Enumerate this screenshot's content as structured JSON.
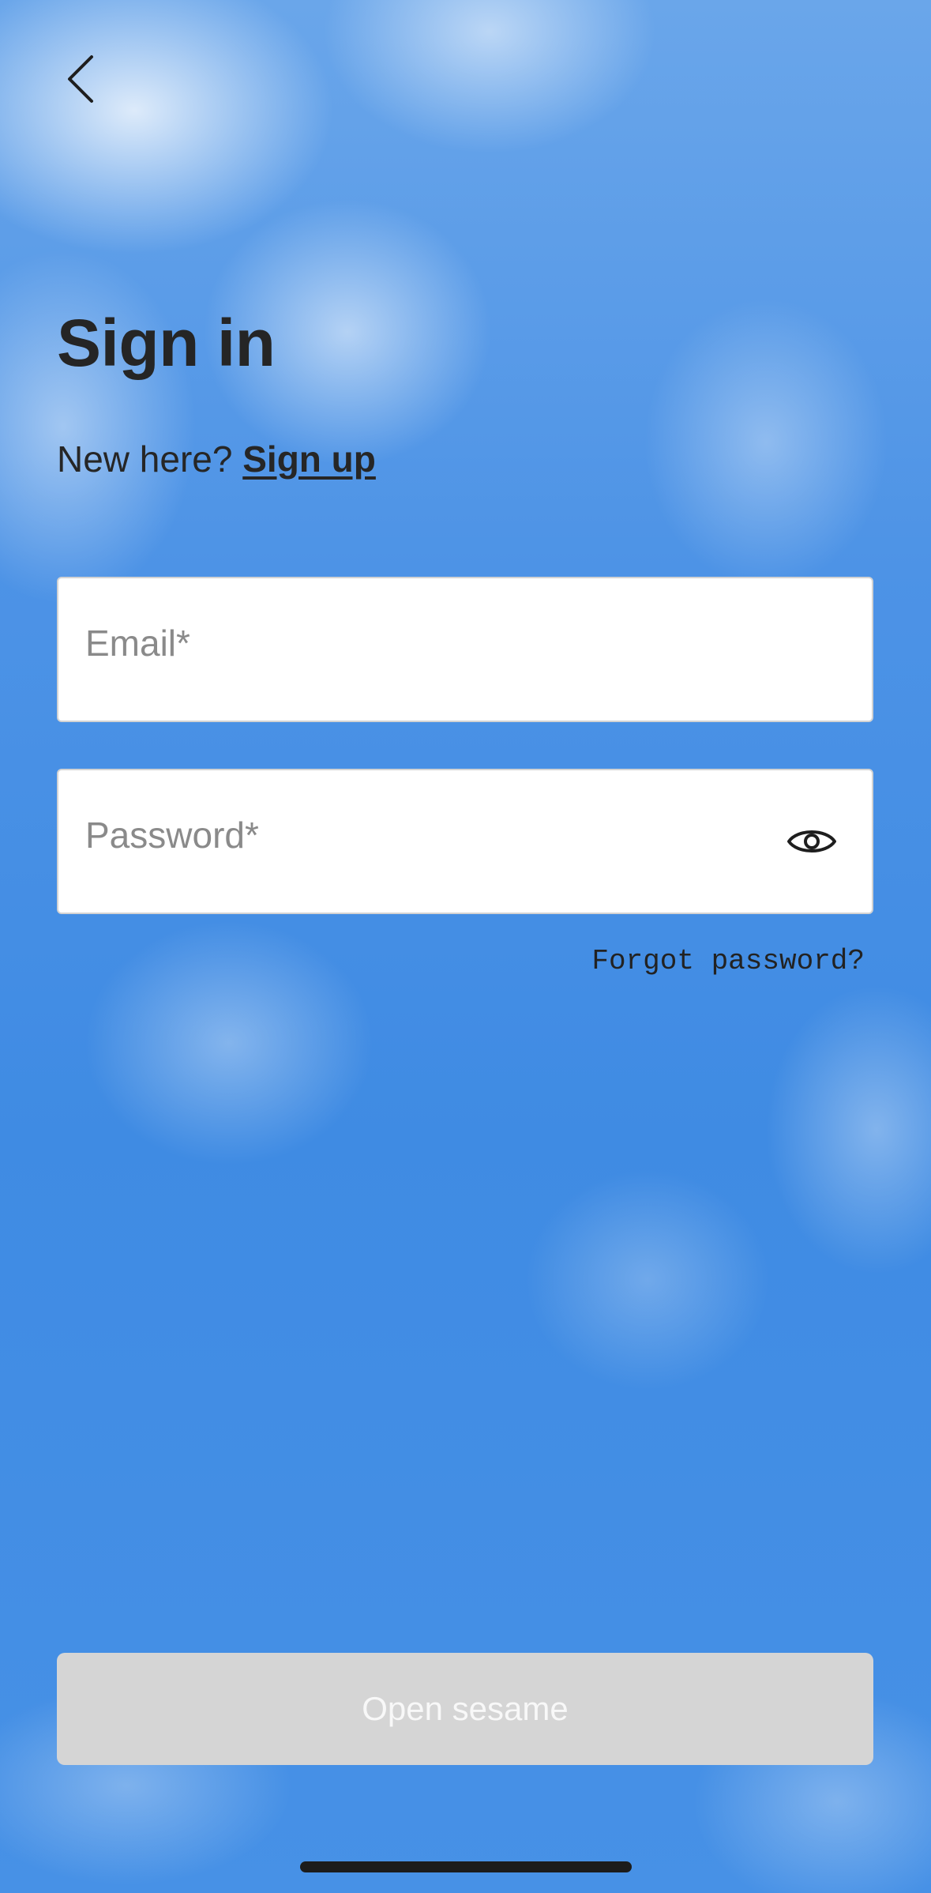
{
  "header": {
    "back_icon": "chevron-left-icon"
  },
  "main": {
    "title": "Sign in",
    "new_here_text": "New here?",
    "signup_link": "Sign up"
  },
  "form": {
    "email": {
      "value": "",
      "placeholder": "Email*"
    },
    "password": {
      "value": "",
      "placeholder": "Password*",
      "toggle_icon": "eye-icon"
    },
    "forgot_password": "Forgot password?",
    "submit_label": "Open sesame"
  },
  "colors": {
    "text": "#222222",
    "button_disabled_bg": "#d5d5d5",
    "button_disabled_text": "#f8f8f8",
    "field_border": "#d3d3d3",
    "sky": "#3f8be3"
  }
}
